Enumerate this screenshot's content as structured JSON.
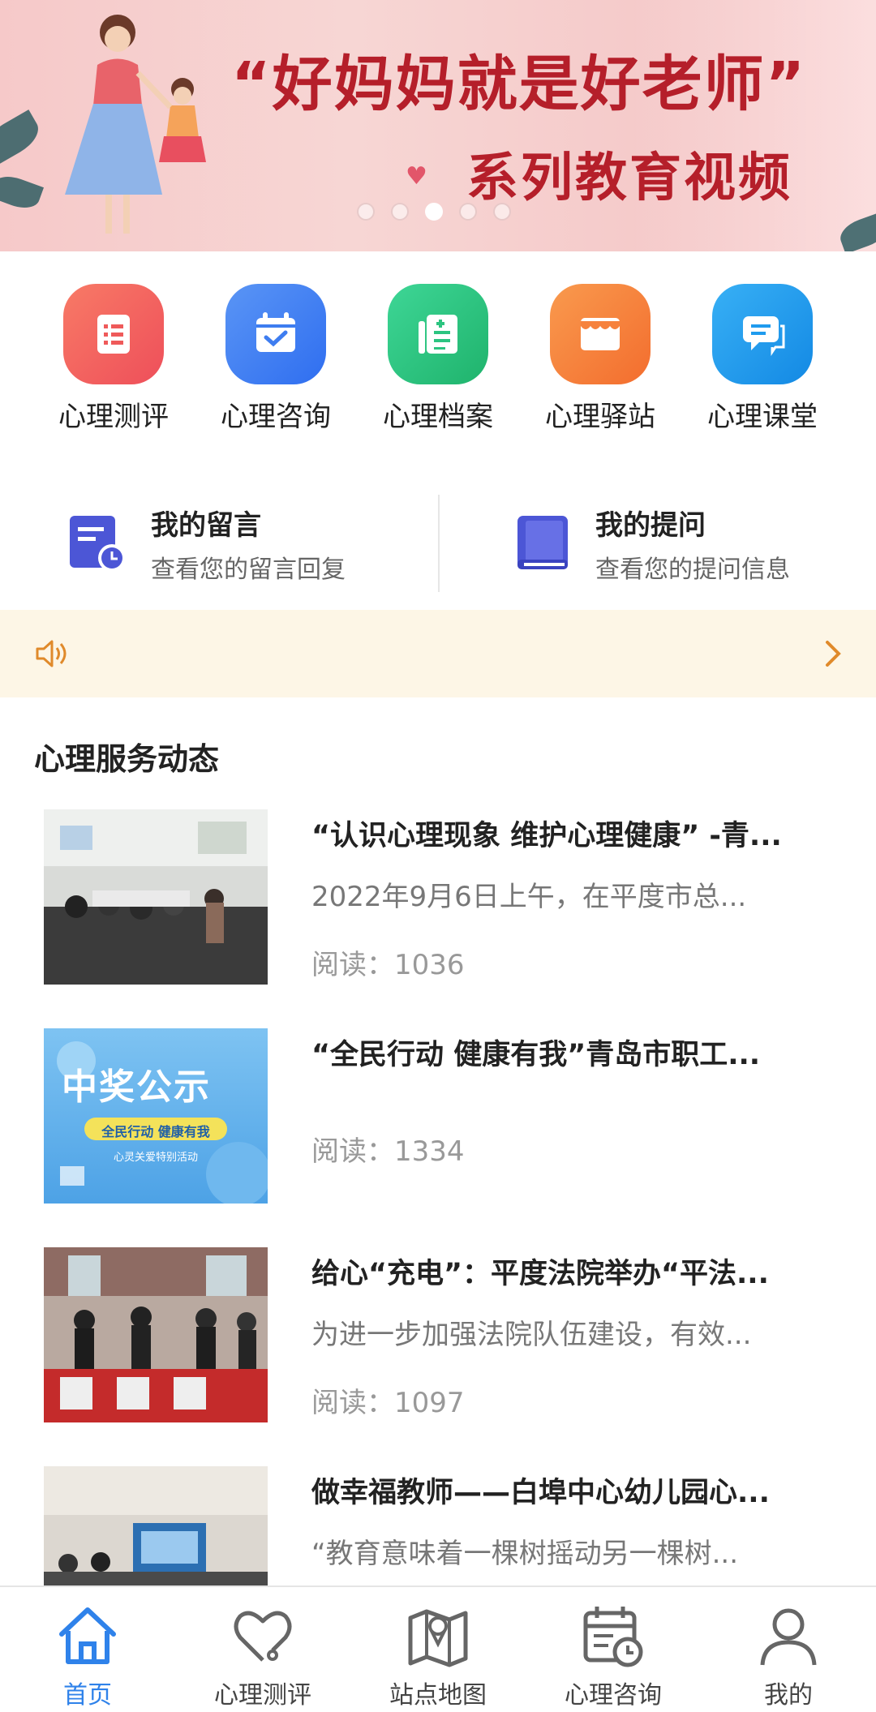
{
  "banner": {
    "title_line1": "“好妈妈就是好老师”",
    "title_line2": "系列教育视频",
    "active_dot": 2,
    "dot_count": 5
  },
  "functions": [
    {
      "label": "心理测评",
      "icon": "checklist-icon",
      "color": "#f2655e"
    },
    {
      "label": "心理咨询",
      "icon": "calendar-check-icon",
      "color": "#3e7df0"
    },
    {
      "label": "心理档案",
      "icon": "archive-icon",
      "color": "#2cc480"
    },
    {
      "label": "心理驿站",
      "icon": "store-icon",
      "color": "#f6823d"
    },
    {
      "label": "心理课堂",
      "icon": "chat-icon",
      "color": "#1f9bee"
    }
  ],
  "messages": [
    {
      "title": "我的留言",
      "subtitle": "查看您的留言回复",
      "icon": "message-clock-icon"
    },
    {
      "title": "我的提问",
      "subtitle": "查看您的提问信息",
      "icon": "book-icon"
    }
  ],
  "notice": {
    "icon": "speaker-icon",
    "arrow": "chevron-right-icon"
  },
  "section": {
    "title": "心理服务动态"
  },
  "news": [
    {
      "title": "“认识心理现象 维护心理健康” -青...",
      "summary": "2022年9月6日上午，在平度市总...",
      "reads": "阅读：1036"
    },
    {
      "title": "“全民行动 健康有我”青岛市职工...",
      "summary": "",
      "reads": "阅读：1334",
      "thumb_title": "中奖公示",
      "thumb_sub": "全民行动 健康有我",
      "thumb_sub2": "心灵关爱特别活动"
    },
    {
      "title": "给心“充电”：平度法院举办“平法...",
      "summary": "为进一步加强法院队伍建设，有效...",
      "reads": "阅读：1097"
    },
    {
      "title": "做幸福教师——白埠中心幼儿园心...",
      "summary": "“教育意味着一棵树摇动另一棵树...",
      "reads": ""
    }
  ],
  "tabs": [
    {
      "label": "首页",
      "icon": "home-icon",
      "active": true
    },
    {
      "label": "心理测评",
      "icon": "heart-stethoscope-icon",
      "active": false
    },
    {
      "label": "站点地图",
      "icon": "map-icon",
      "active": false
    },
    {
      "label": "心理咨询",
      "icon": "calendar-clock-icon",
      "active": false
    },
    {
      "label": "我的",
      "icon": "user-icon",
      "active": false
    }
  ],
  "colors": {
    "accent": "#2f82ea",
    "banner_text": "#b51f2a",
    "notice_bg": "#fdf6e6",
    "notice_icon": "#e08a2b"
  }
}
